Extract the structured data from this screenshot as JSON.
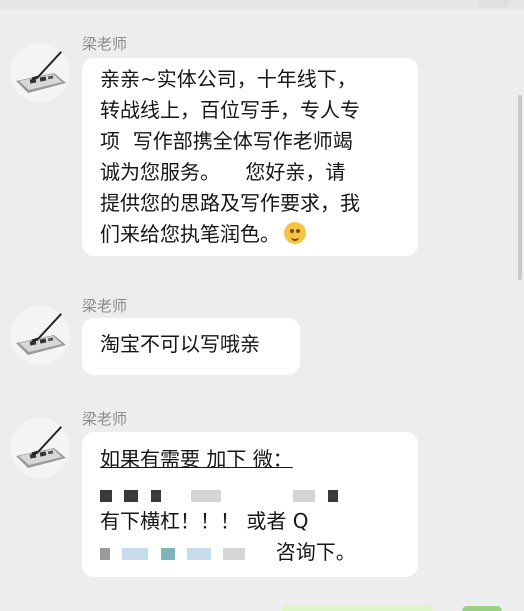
{
  "messages": [
    {
      "sender": "梁老师",
      "lines": [
        "亲亲~实体公司，十年线下，",
        "转战线上，百位写手，专人专",
        "项  写作部携全体写作老师竭",
        "诚为您服务。    您好亲，请",
        "提供您的思路及写作要求，我",
        "们来给您执笔润色。"
      ],
      "trailing_emoji": "smiling-face-emoji"
    },
    {
      "sender": "梁老师",
      "lines": [
        "淘宝不可以写哦亲"
      ]
    },
    {
      "sender": "梁老师",
      "line1": "如果有需要 加下 微：",
      "line3": "有下横杠！！！ 或者 Q",
      "line4_suffix": "咨询下。"
    }
  ],
  "colors": {
    "background": "#ededed",
    "bubble": "#ffffff",
    "sender": "#8a8a8a",
    "text": "#161616"
  }
}
